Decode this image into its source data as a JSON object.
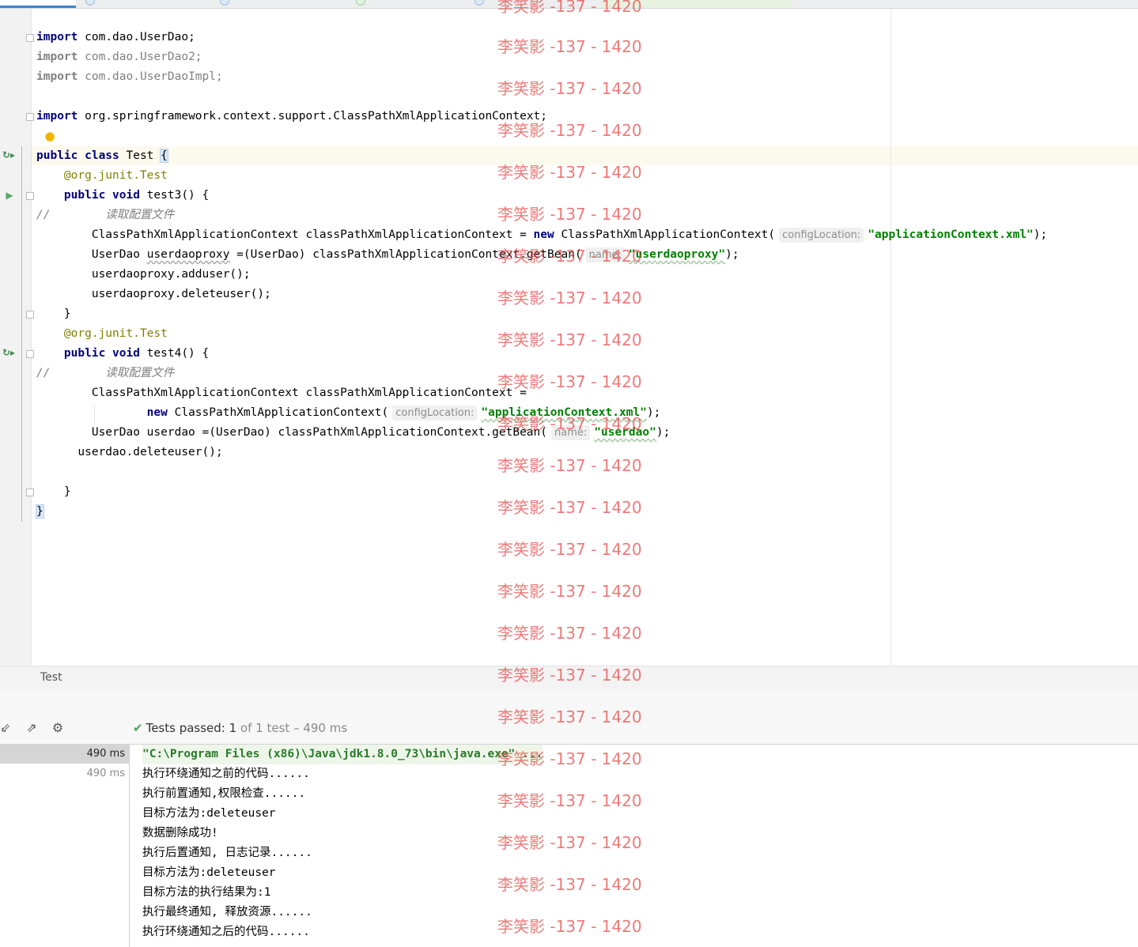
{
  "editor": {
    "lines": {
      "l1_kw": "import",
      "l1_rest": " com.dao.UserDao;",
      "l2_kw": "import",
      "l2_rest": " com.dao.UserDao2;",
      "l3_kw": "import",
      "l3_rest": " com.dao.UserDaoImpl;",
      "l5_kw": "import",
      "l5_rest": " org.springframework.context.support.ClassPathXmlApplicationContext;",
      "l7_kw": "public class",
      "l7_rest": " Test ",
      "l7_brace": "{",
      "l8_a": "    @org.junit.",
      "l8_b": "Test",
      "l9_kw": "    public void",
      "l9_rest": " test3() {",
      "l10_c1": "//",
      "l10_c2": "        读取配置文件",
      "l11_a": "        ClassPathXmlApplicationContext classPathXmlApplicationContext = ",
      "l11_kw": "new",
      "l11_b": " ClassPathXmlApplicationContext(",
      "l11_hint": "configLocation:",
      "l11_str": "\"applicationContext.xml\"",
      "l11_c": ");",
      "l12_a": "        UserDao ",
      "l12_var": "userdaoproxy",
      "l12_b": " =(UserDao) classPathXmlApplicationContext.getBean(",
      "l12_hint": "name:",
      "l12_str": "\"userdaoproxy\"",
      "l12_c": ");",
      "l13": "        userdaoproxy.adduser();",
      "l14": "        userdaoproxy.deleteuser();",
      "l15": "    }",
      "l16_a": "    @org.junit.",
      "l16_b": "Test",
      "l17_kw": "    public void",
      "l17_rest": " test4() {",
      "l18_c1": "//",
      "l18_c2": "        读取配置文件",
      "l19": "        ClassPathXmlApplicationContext classPathXmlApplicationContext =",
      "l20_kw": "                new",
      "l20_b": " ClassPathXmlApplicationContext(",
      "l20_hint": "configLocation:",
      "l20_str": "\"applicationContext.xml\"",
      "l20_c": ");",
      "l21_a": "        UserDao userdao =(UserDao) classPathXmlApplicationContext.getBean(",
      "l21_hint": "name:",
      "l21_str": "\"userdao\"",
      "l21_c": ");",
      "l22": "      userdao.deleteuser();",
      "l24": "    }",
      "l25": "}"
    }
  },
  "breadcrumb": {
    "label": "Test"
  },
  "run": {
    "status_label": "Tests passed:",
    "status_count": "1",
    "status_rest": "of 1 test – 490 ms",
    "tree": [
      {
        "time": "490 ms"
      },
      {
        "time": "490 ms"
      }
    ],
    "console": [
      "\"C:\\Program Files (x86)\\Java\\jdk1.8.0_73\\bin\\java.exe\" ...",
      "执行环绕通知之前的代码......",
      "执行前置通知,权限检查......",
      "目标方法为:deleteuser",
      "数据删除成功!",
      "执行后置通知, 日志记录......",
      "目标方法为:deleteuser",
      "目标方法的执行结果为:1",
      "执行最终通知, 释放资源......",
      "执行环绕通知之后的代码......"
    ]
  },
  "icons": {
    "run_test": "run-icon",
    "rerun_test": "rerun-icon",
    "intention_bulb": "bulb-icon",
    "fold_marker": "fold-icon",
    "collapse_all": "collapse-icon",
    "export": "export-icon",
    "settings": "gear-icon",
    "tests_passed": "check-icon"
  },
  "colors": {
    "keyword": "#000080",
    "string": "#008000",
    "annotation": "#808000",
    "comment": "#808080",
    "pass_green": "#4ca05c",
    "watermark": "#e84646"
  },
  "watermark": {
    "text": "李笑影 -137 - 1420"
  }
}
